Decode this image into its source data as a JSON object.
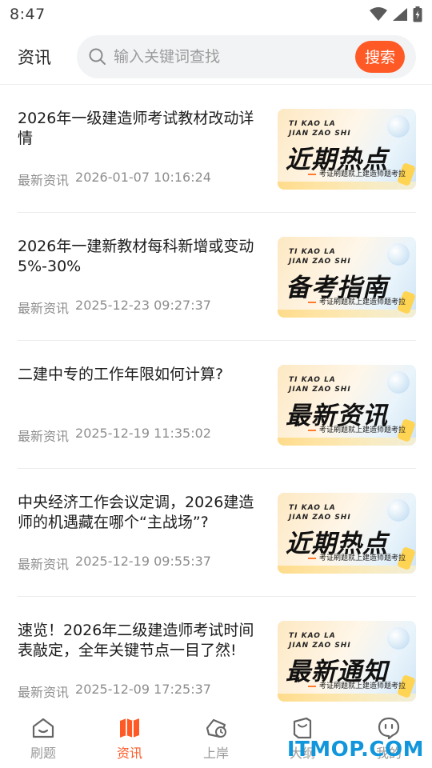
{
  "status": {
    "time": "8:47"
  },
  "header": {
    "title": "资讯",
    "search_placeholder": "输入关键词查找",
    "search_button": "搜索"
  },
  "news": [
    {
      "title": "2026年一级建造师考试教材改动详情",
      "category": "最新资讯",
      "date": "2026-01-07 10:16:24",
      "thumb_top1": "TI KAO LA",
      "thumb_top2": "JIAN ZAO SHI",
      "thumb_main": "近期热点",
      "thumb_sub": "考证刷题就上建造师题考拉"
    },
    {
      "title": "2026年一建新教材每科新增或变动5%-30%",
      "category": "最新资讯",
      "date": "2025-12-23 09:27:37",
      "thumb_top1": "TI KAO LA",
      "thumb_top2": "JIAN ZAO SHI",
      "thumb_main": "备考指南",
      "thumb_sub": "考证刷题就上建造师题考拉"
    },
    {
      "title": "二建中专的工作年限如何计算?",
      "category": "最新资讯",
      "date": "2025-12-19 11:35:02",
      "thumb_top1": "TI KAO LA",
      "thumb_top2": "JIAN ZAO SHI",
      "thumb_main": "最新资讯",
      "thumb_sub": "考证刷题就上建造师题考拉"
    },
    {
      "title": "中央经济工作会议定调，2026建造师的机遇藏在哪个“主战场”?",
      "category": "最新资讯",
      "date": "2025-12-19 09:55:37",
      "thumb_top1": "TI KAO LA",
      "thumb_top2": "JIAN ZAO SHI",
      "thumb_main": "近期热点",
      "thumb_sub": "考证刷题就上建造师题考拉"
    },
    {
      "title": "速览！2026年二级建造师考试时间表敲定，全年关键节点一目了然!",
      "category": "最新资讯",
      "date": "2025-12-09 17:25:37",
      "thumb_top1": "TI KAO LA",
      "thumb_top2": "JIAN ZAO SHI",
      "thumb_main": "最新通知",
      "thumb_sub": "考证刷题就上建造师题考拉"
    }
  ],
  "tabs": [
    {
      "label": "刷题",
      "icon": "home-icon",
      "active": false
    },
    {
      "label": "资讯",
      "icon": "map-icon",
      "active": true
    },
    {
      "label": "上岸",
      "icon": "bag-clock-icon",
      "active": false
    },
    {
      "label": "大纲",
      "icon": "book-icon",
      "active": false
    },
    {
      "label": "我的",
      "icon": "chat-face-icon",
      "active": false
    }
  ],
  "watermark": "ITMOP.COM",
  "colors": {
    "accent": "#ff5a26",
    "watermark": "#1296db"
  }
}
